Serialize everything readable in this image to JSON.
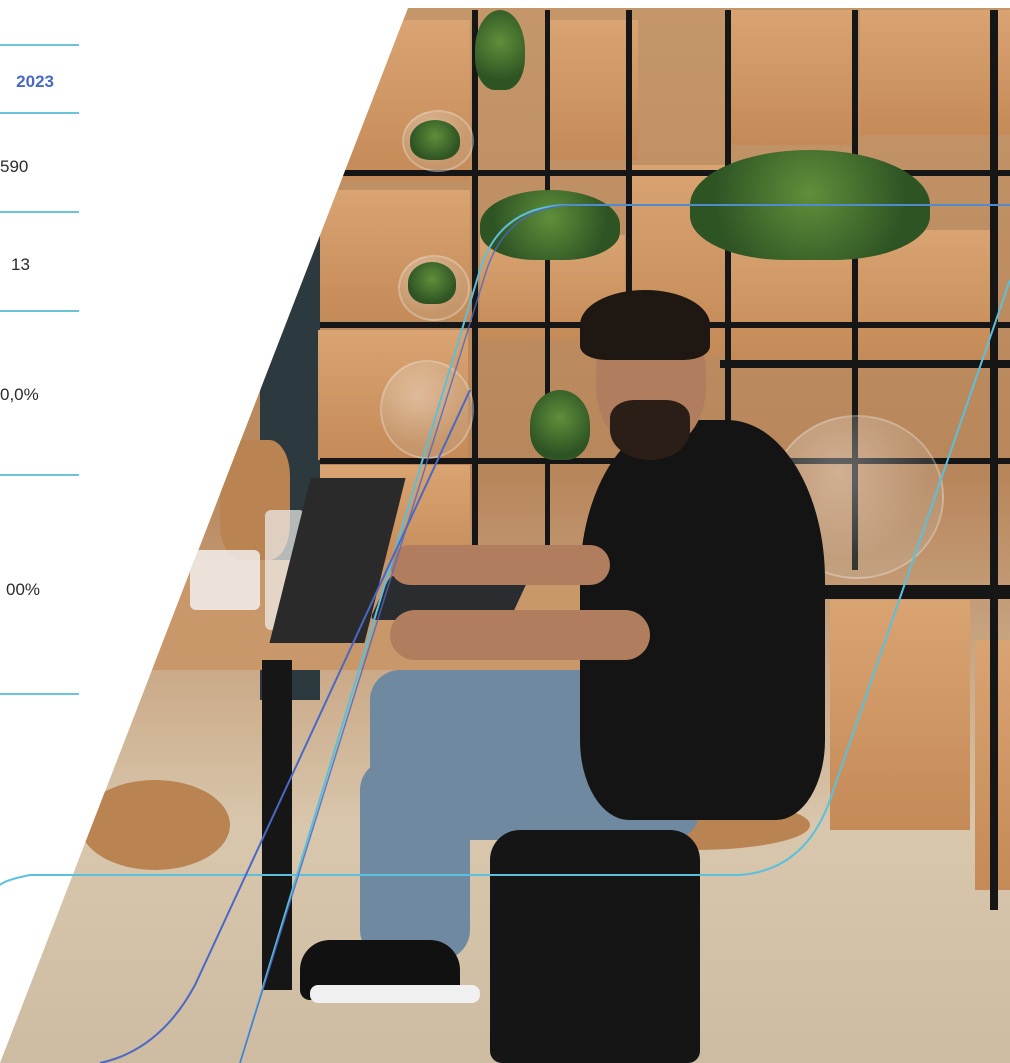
{
  "table": {
    "year_header": "2023",
    "values": [
      "590",
      "13",
      "0,0%",
      "00%"
    ]
  },
  "colors": {
    "accent_blue": "#4a68c6",
    "rule_cyan": "#6cc4dc",
    "line_cyan": "#5bc0dc"
  },
  "photo": {
    "icon": "photo-of-man-working-on-laptop"
  }
}
